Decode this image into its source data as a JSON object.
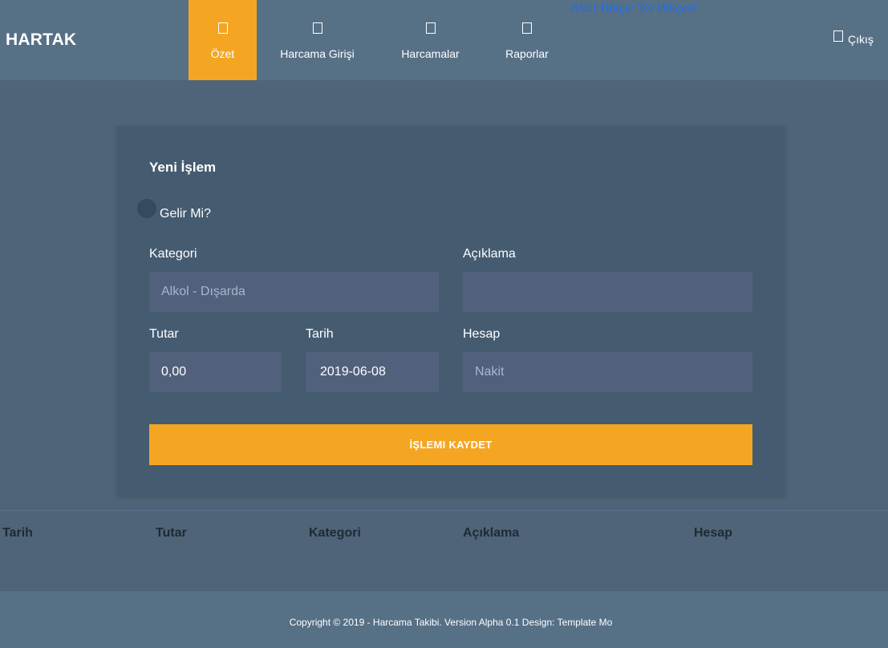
{
  "header": {
    "brand": "HARTAK",
    "nav": [
      {
        "label": "Özet",
        "icon": "home-icon",
        "active": true
      },
      {
        "label": "Harcama Girişi",
        "icon": "edit-icon",
        "active": false
      },
      {
        "label": "Harcamalar",
        "icon": "list-icon",
        "active": false
      },
      {
        "label": "Raporlar",
        "icon": "chart-icon",
        "active": false
      }
    ],
    "active_budget": "Aktif Bütçe: 'Ev Bütçesi'",
    "logout_label": "Çıkış",
    "logout_icon": "sign-out-icon"
  },
  "form": {
    "title": "Yeni İşlem",
    "income_label": "Gelir Mi?",
    "category": {
      "label": "Kategori",
      "value": "Alkol - Dışarda"
    },
    "description": {
      "label": "Açıklama",
      "value": ""
    },
    "amount": {
      "label": "Tutar",
      "value": "0,00"
    },
    "date": {
      "label": "Tarih",
      "value": "2019-06-08"
    },
    "account": {
      "label": "Hesap",
      "value": "Nakit"
    },
    "save_label": "İŞLEMI KAYDET"
  },
  "table": {
    "columns": [
      "Tarih",
      "Tutar",
      "Kategori",
      "Açıklama",
      "Hesap"
    ]
  },
  "footer": {
    "text": "Copyright © 2019 - Harcama Takibi. Version Alpha 0.1 Design: Template Mo"
  },
  "colors": {
    "accent": "#f4a623",
    "header_bg": "#567086",
    "page_bg": "#4f6478",
    "panel_bg": "#445b70",
    "input_bg": "#51617c",
    "link": "#1a6ef5"
  }
}
